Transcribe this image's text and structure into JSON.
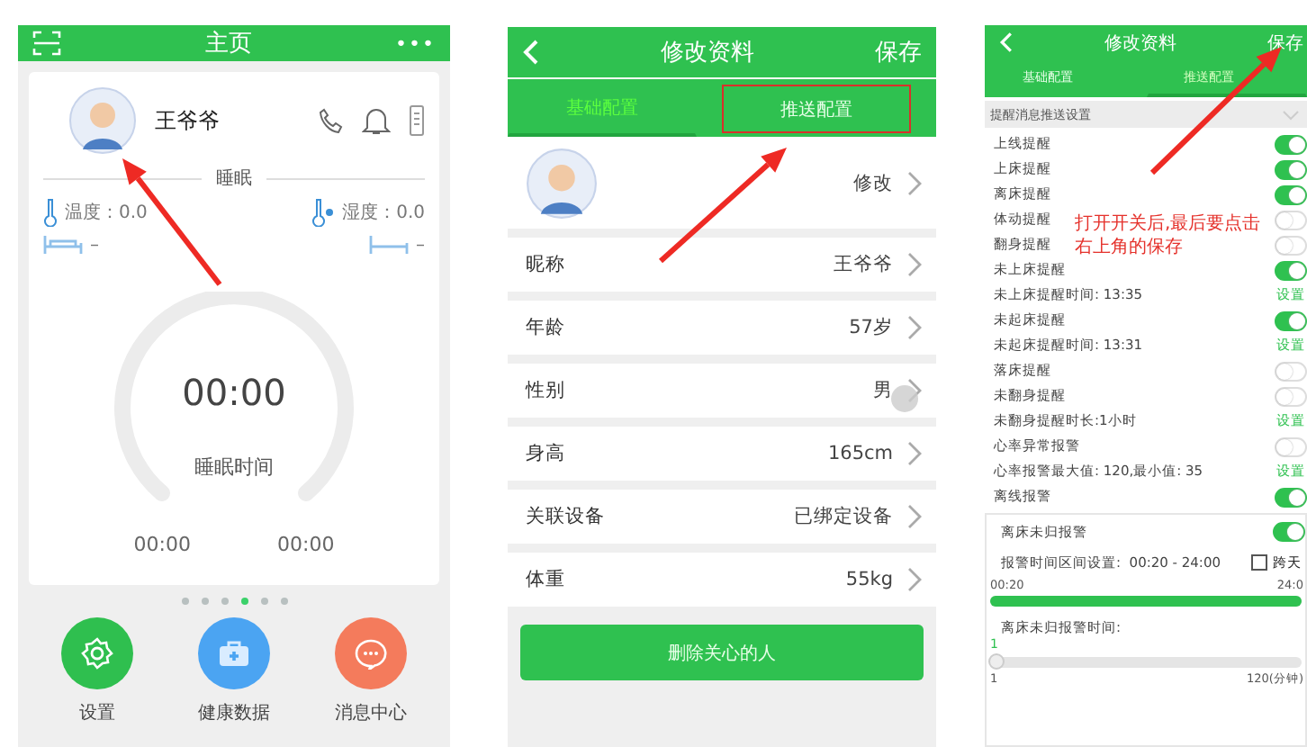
{
  "home": {
    "title": "主页",
    "more": "•••",
    "user": {
      "name": "王爷爷"
    },
    "section": "睡眠",
    "readings": [
      {
        "kind": "temperature",
        "label": "温度：0.0"
      },
      {
        "kind": "humidity",
        "label": "湿度：0.0"
      }
    ],
    "beds": [
      {
        "kind": "in",
        "value": "–"
      },
      {
        "kind": "out",
        "value": "–"
      }
    ],
    "gauge": {
      "time": "00:00",
      "label": "睡眠时间"
    },
    "times": [
      "00:00",
      "00:00"
    ],
    "pages": [
      {
        "selected": false
      },
      {
        "selected": false
      },
      {
        "selected": false
      },
      {
        "selected": true
      },
      {
        "selected": false
      },
      {
        "selected": false
      }
    ],
    "actions": [
      {
        "kind": "settings",
        "label": "设置",
        "color": "#2fbf4f"
      },
      {
        "kind": "health",
        "label": "健康数据",
        "color": "#4ba4f2"
      },
      {
        "kind": "messages",
        "label": "消息中心",
        "color": "#f47b5c"
      }
    ]
  },
  "profile": {
    "title": "修改资料",
    "save": "保存",
    "tabs": [
      {
        "label": "基础配置",
        "selected": true,
        "highlighted": false
      },
      {
        "label": "推送配置",
        "selected": false,
        "highlighted": true
      }
    ],
    "avatar_action": "修改",
    "fields": [
      {
        "label": "昵称",
        "value": "王爷爷"
      },
      {
        "label": "年龄",
        "value": "57岁"
      },
      {
        "label": "性别",
        "value": "男"
      },
      {
        "label": "身高",
        "value": "165cm"
      },
      {
        "label": "关联设备",
        "value": "已绑定设备"
      },
      {
        "label": "体重",
        "value": "55kg"
      }
    ],
    "delete_button": "删除关心的人"
  },
  "push": {
    "title": "修改资料",
    "save": "保存",
    "tabs": [
      {
        "label": "基础配置",
        "selected": false
      },
      {
        "label": "推送配置",
        "selected": true
      }
    ],
    "section": "提醒消息推送设置",
    "rows": [
      {
        "kind": "toggle",
        "label": "上线提醒",
        "on": true
      },
      {
        "kind": "toggle",
        "label": "上床提醒",
        "on": true
      },
      {
        "kind": "toggle",
        "label": "离床提醒",
        "on": true
      },
      {
        "kind": "toggle",
        "label": "体动提醒",
        "on": false
      },
      {
        "kind": "toggle",
        "label": "翻身提醒",
        "on": false
      },
      {
        "kind": "toggle",
        "label": "未上床提醒",
        "on": true
      },
      {
        "kind": "setting",
        "label": "未上床提醒时间: 13:35",
        "action": "设置"
      },
      {
        "kind": "toggle",
        "label": "未起床提醒",
        "on": true
      },
      {
        "kind": "setting",
        "label": "未起床提醒时间: 13:31",
        "action": "设置"
      },
      {
        "kind": "toggle",
        "label": "落床提醒",
        "on": false
      },
      {
        "kind": "toggle",
        "label": "未翻身提醒",
        "on": false
      },
      {
        "kind": "setting",
        "label": "未翻身提醒时长:1小时",
        "action": "设置"
      },
      {
        "kind": "toggle",
        "label": "心率异常报警",
        "on": false
      },
      {
        "kind": "setting",
        "label": "心率报警最大值: 120,最小值: 35",
        "action": "设置"
      },
      {
        "kind": "toggle",
        "label": "离线报警",
        "on": true
      }
    ],
    "absence": {
      "label": "离床未归报警",
      "on": true,
      "range_label": "报警时间区间设置:  00:20 - 24:00",
      "cross_day": {
        "label": "跨天",
        "checked": false
      },
      "range": {
        "start": "00:20",
        "end": "24:0",
        "level": 1
      },
      "duration_label": "离床未归报警时间:",
      "duration_value": "1",
      "duration": {
        "level": 0,
        "min": "1",
        "max": "120(分钟)"
      }
    }
  },
  "annotation": {
    "note": "打开开关后,最后要点击右上角的保存"
  }
}
